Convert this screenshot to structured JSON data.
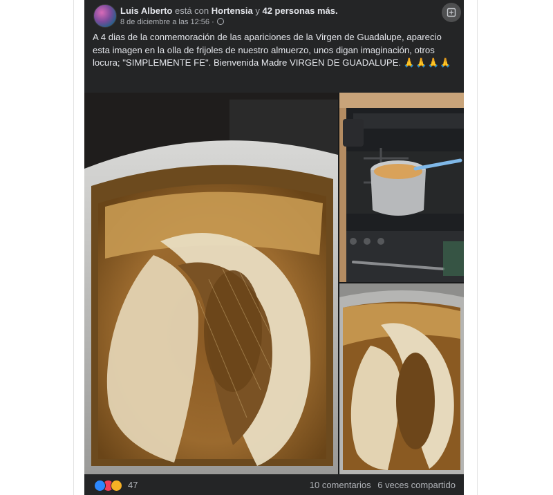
{
  "post": {
    "author": "Luis Alberto",
    "with_connector": "está con",
    "tagged_friend": "Hortensia",
    "and_connector": "y",
    "others": "42 personas más.",
    "timestamp": "8 de diciembre a las 12:56 ·",
    "privacy_icon": "globe-icon",
    "text": "A 4 dias de la conmemoración de las apariciones de la Virgen de Guadalupe, aparecio esta imagen en la olla de frijoles de nuestro almuerzo, unos digan imaginación, otros locura; \"SIMPLEMENTE FE\". Bienvenida Madre VIRGEN DE GUADALUPE.",
    "emoji": "🙏🙏🙏🙏"
  },
  "photos": [
    {
      "name": "bean-pot-closeup"
    },
    {
      "name": "stove-with-pot"
    },
    {
      "name": "bean-pot-detail"
    }
  ],
  "footer": {
    "reaction_icons": [
      "like-icon",
      "love-icon",
      "haha-icon"
    ],
    "reaction_count": "47",
    "comments": "10 comentarios",
    "shares": "6 veces compartido"
  },
  "colors": {
    "card_bg": "#242526",
    "primary_text": "#e4e6eb",
    "secondary_text": "#b0b3b8",
    "like": "#2d88ff",
    "love": "#f33e58",
    "haha": "#f7b125"
  }
}
